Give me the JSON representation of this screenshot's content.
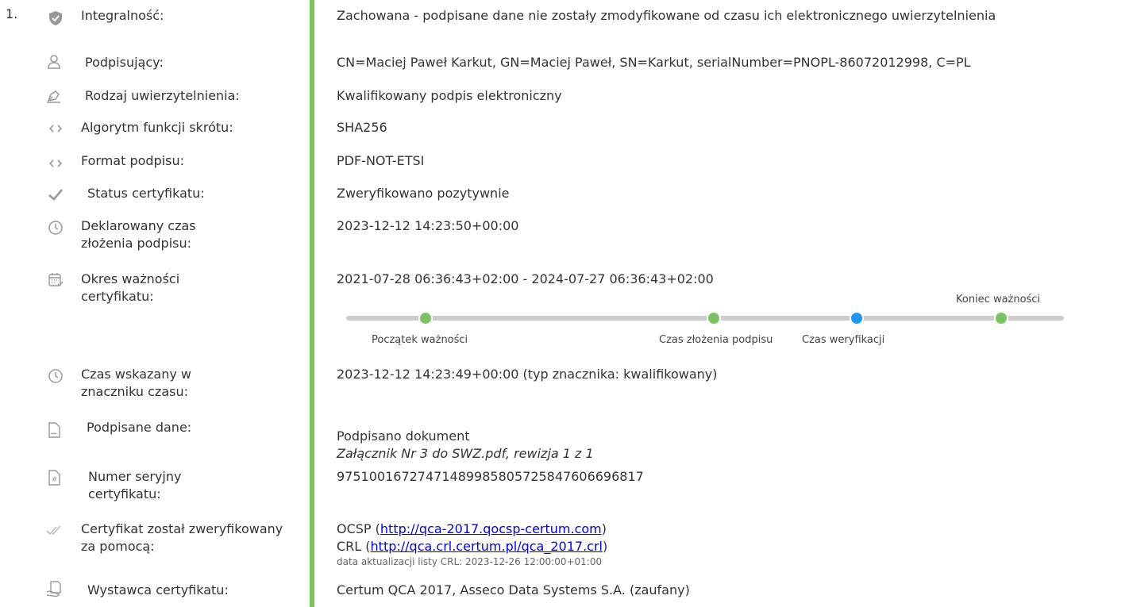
{
  "entry_number": "1.",
  "rows": [
    {
      "label": "Integralność:",
      "value": "Zachowana - podpisane dane nie zostały zmodyfikowane od czasu ich elektronicznego uwierzytelnienia"
    },
    {
      "label": "Podpisujący:",
      "value": "CN=Maciej Paweł Karkut, GN=Maciej Paweł, SN=Karkut, serialNumber=PNOPL-86072012998, C=PL"
    },
    {
      "label": "Rodzaj uwierzytelnienia:",
      "value": "Kwalifikowany podpis elektroniczny"
    },
    {
      "label": "Algorytm funkcji skrótu:",
      "value": "SHA256"
    },
    {
      "label": "Format podpisu:",
      "value": "PDF-NOT-ETSI"
    },
    {
      "label": "Status certyfikatu:",
      "value": "Zweryfikowano pozytywnie"
    },
    {
      "label": "Deklarowany czas złożenia podpisu:",
      "value": "2023-12-12 14:23:50+00:00"
    },
    {
      "label": "Okres ważności certyfikatu:",
      "value": "2021-07-28 06:36:43+02:00 - 2024-07-27 06:36:43+02:00"
    },
    {
      "label": "Czas wskazany w znaczniku czasu:",
      "value": "2023-12-12 14:23:49+00:00 (typ znacznika: kwalifikowany)"
    },
    {
      "label": "Podpisane dane:",
      "value": "Podpisano dokument",
      "value2": "Załącznik Nr 3 do SWZ.pdf, rewizja 1 z 1"
    },
    {
      "label": "Numer seryjny certyfikatu:",
      "value": "97510016727471489985805725847606696817"
    },
    {
      "label": "Certyfikat został zweryfikowany za pomocą:",
      "ocsp_prefix": "OCSP (",
      "ocsp_link": "http://qca-2017.qocsp-certum.com",
      "ocsp_suffix": ")",
      "crl_prefix": "CRL (",
      "crl_link": "http://qca.crl.certum.pl/qca_2017.crl",
      "crl_suffix": ")",
      "crl_update": "data aktualizacji listy CRL: 2023-12-26 12:00:00+01:00"
    },
    {
      "label": "Wystawca certyfikatu:",
      "value": "Certum QCA 2017, Asseco Data Systems S.A. (zaufany)"
    }
  ],
  "timeline": {
    "start_label": "Początek ważności",
    "signing_label": "Czas złożenia podpisu",
    "verification_label": "Czas weryfikacji",
    "end_label": "Koniec ważności"
  },
  "colors": {
    "accent_bar": "#7ac264",
    "dot_green": "#7ac264",
    "dot_blue": "#2196f3",
    "track": "#cccccc"
  },
  "icons": [
    "shield-check-icon",
    "user-icon",
    "pen-icon",
    "code-icon",
    "code-icon",
    "checkmark-icon",
    "clock-icon",
    "calendar-check-icon",
    "clock-icon",
    "document-signature-icon",
    "document-hash-icon",
    "double-check-icon",
    "document-hand-icon"
  ]
}
